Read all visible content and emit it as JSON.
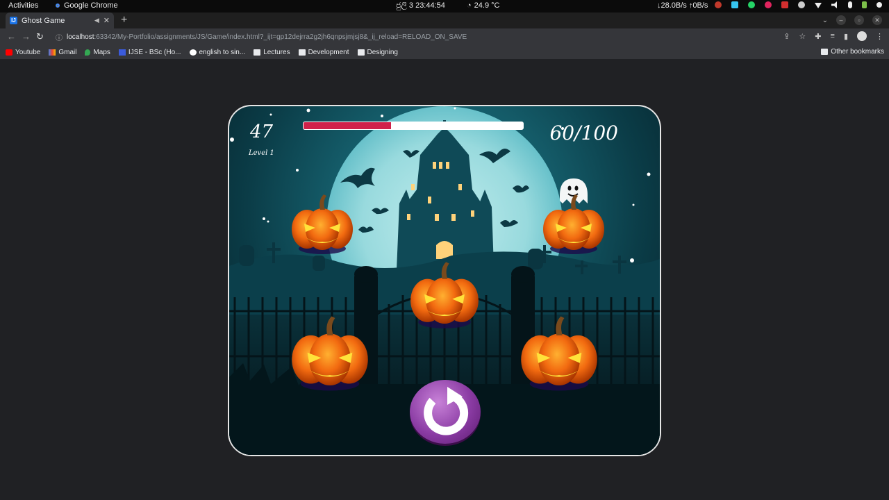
{
  "system": {
    "activities": "Activities",
    "app_name": "Google Chrome",
    "clock": "ජුලි 3  23:44:54",
    "temperature": "24.9 °C",
    "network": "↓28.0B/s ↑0B/s"
  },
  "tab": {
    "title": "Ghost Game"
  },
  "omnibox": {
    "host": "localhost",
    "path": ":63342/My-Portfolio/assignments/JS/Game/index.html?_ijt=gp12dejrra2g2jh6qnpsjmjsj8&_ij_reload=RELOAD_ON_SAVE"
  },
  "bookmarks": {
    "items": [
      "Youtube",
      "Gmail",
      "Maps",
      "IJSE - BSc (Ho...",
      "english to sin...",
      "Lectures",
      "Development",
      "Designing"
    ],
    "other": "Other bookmarks"
  },
  "game": {
    "score": "47",
    "level": "Level 1",
    "progress": 0.4,
    "counter": "60/100"
  },
  "colors": {
    "progress_fill": "#d0214a",
    "restart_button": "#8a3ba3",
    "pumpkin": "#f26a10"
  }
}
